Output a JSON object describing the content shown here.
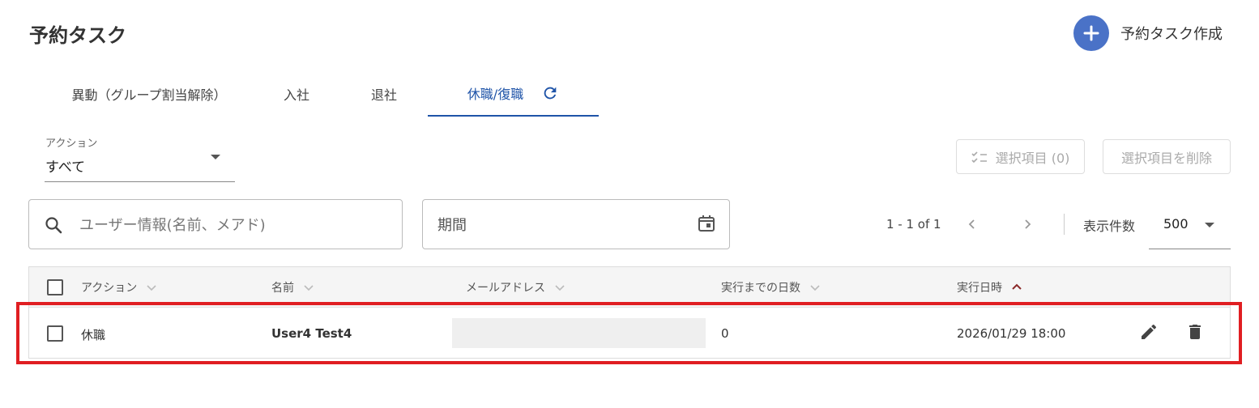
{
  "header": {
    "title": "予約タスク",
    "create_label": "予約タスク作成"
  },
  "tabs": [
    {
      "label": "異動（グループ割当解除）",
      "active": false
    },
    {
      "label": "入社",
      "active": false
    },
    {
      "label": "退社",
      "active": false
    },
    {
      "label": "休職/復職",
      "active": true
    }
  ],
  "filters": {
    "action_label": "アクション",
    "action_value": "すべて",
    "search_placeholder": "ユーザー情報(名前、メアド)",
    "period_placeholder": "期間"
  },
  "selection": {
    "count_label": "選択項目 (0)",
    "delete_label": "選択項目を削除"
  },
  "pagination": {
    "info": "1 - 1 of 1",
    "per_page_label": "表示件数",
    "per_page_value": "500"
  },
  "table": {
    "headers": {
      "action": "アクション",
      "name": "名前",
      "email": "メールアドレス",
      "days_until": "実行までの日数",
      "exec_datetime": "実行日時"
    },
    "rows": [
      {
        "action": "休職",
        "name": "User4 Test4",
        "email": "",
        "days_until": "0",
        "exec_datetime": "2026/01/29 18:00"
      }
    ]
  },
  "colors": {
    "accent": "#1f54a8",
    "create_button": "#4a72c7",
    "highlight": "#e01e22",
    "sort_active": "#8b2a2a"
  },
  "icons": [
    "plus-icon",
    "refresh-icon",
    "caret-down-icon",
    "checklist-icon",
    "search-icon",
    "calendar-icon",
    "chevron-left-icon",
    "chevron-right-icon",
    "chevron-down-icon",
    "chevron-up-icon",
    "edit-icon",
    "delete-icon"
  ]
}
